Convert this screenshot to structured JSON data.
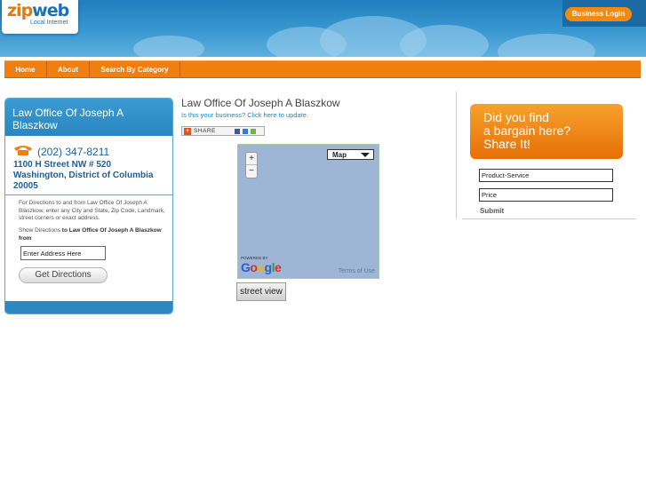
{
  "header": {
    "logo_text_a": "zip",
    "logo_text_b": "web",
    "logo_tagline": "Local Internet",
    "login_label": "Business Login"
  },
  "nav": {
    "items": [
      {
        "label": "Home"
      },
      {
        "label": "About"
      },
      {
        "label": "Search By Category"
      }
    ]
  },
  "listing": {
    "name": "Law Office Of Joseph A Blaszkow",
    "phone": "(202) 347-8211",
    "address_line1": "1100 H Street NW # 520",
    "address_line2": "Washington, District of Columbia",
    "address_line3": "20005",
    "directions_help": "For Directions to and from Law Office Of Joseph A Blaszkow, enter any City and State, Zip Code, Landmark, street corners or exact address.",
    "show_directions_prefix": "Show Directions",
    "show_directions_to": "to Law Office Of Joseph A Blaszkow",
    "show_directions_suffix": "from",
    "address_input_value": "Enter Address Here",
    "get_directions_label": "Get Directions"
  },
  "main": {
    "title": "Law Office Of Joseph A Blaszkow",
    "claim_link": "Is this your business? Click here to update.",
    "share_label": "SHARE"
  },
  "map": {
    "zoom_in": "+",
    "zoom_out": "−",
    "type_label": "Map",
    "powered_by": "POWERED BY",
    "google_letters": [
      "G",
      "o",
      "o",
      "g",
      "l",
      "e"
    ],
    "terms": "Terms of Use",
    "street_view_label": "street view"
  },
  "promo": {
    "line1": "Did you find",
    "line2": "a bargain here?",
    "line3": "Share It!",
    "field1_value": "Product-Service",
    "field2_value": "Price",
    "submit_label": "Submit"
  },
  "colors": {
    "brand_orange": "#f07e10",
    "brand_blue": "#2a86c0"
  }
}
